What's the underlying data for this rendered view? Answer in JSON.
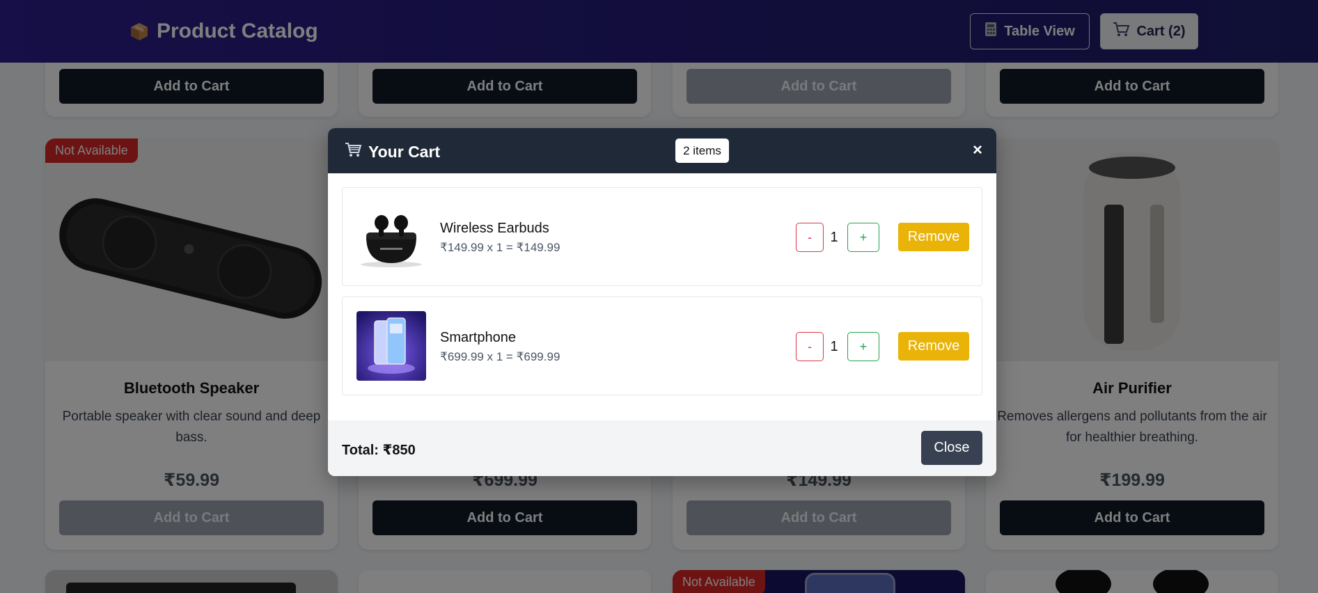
{
  "header": {
    "title": "Product Catalog",
    "table_view_label": "Table View",
    "cart_label": "Cart (2)"
  },
  "products": {
    "add_to_cart_label": "Add to Cart",
    "not_available_label": "Not Available",
    "bluetooth_speaker": {
      "name": "Bluetooth Speaker",
      "description": "Portable speaker with clear sound and deep bass.",
      "price": "₹59.99"
    },
    "smartphone_card": {
      "price": "₹699.99"
    },
    "earbuds_card": {
      "price": "₹149.99"
    },
    "air_purifier": {
      "name": "Air Purifier",
      "description": "Removes allergens and pollutants from the air for healthier breathing.",
      "price": "₹199.99"
    }
  },
  "cart_modal": {
    "title": "Your Cart",
    "item_count": "2 items",
    "close_x": "×",
    "items": [
      {
        "name": "Wireless Earbuds",
        "line": "₹149.99 x 1 = ₹149.99",
        "quantity": "1",
        "minus": "-",
        "plus": "+",
        "remove_label": "Remove"
      },
      {
        "name": "Smartphone",
        "line": "₹699.99 x 1 = ₹699.99",
        "quantity": "1",
        "minus": "-",
        "plus": "+",
        "remove_label": "Remove"
      }
    ],
    "total": "Total: ₹850",
    "close_label": "Close"
  },
  "colors": {
    "header_bg": "#2e1f8f",
    "modal_header_bg": "#1f2937",
    "remove_button": "#eab308",
    "badge_red": "#dc2626"
  }
}
